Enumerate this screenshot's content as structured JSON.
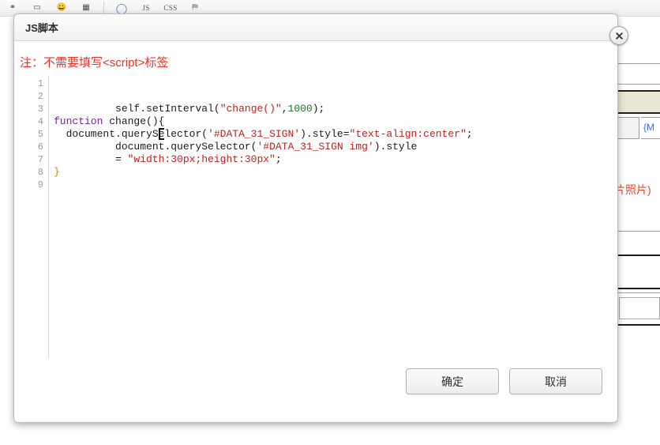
{
  "background": {
    "toolbar": {
      "items": [
        {
          "name": "link-icon",
          "glyph": "⚭"
        },
        {
          "name": "button-icon",
          "glyph": "▭"
        },
        {
          "name": "emoji-icon",
          "glyph": "😀"
        },
        {
          "name": "table-icon",
          "glyph": "▦"
        },
        {
          "name": "separator",
          "glyph": ""
        },
        {
          "name": "circle-icon",
          "glyph": "◯"
        },
        {
          "name": "js-button",
          "glyph": "JS"
        },
        {
          "name": "css-button",
          "glyph": "CSS"
        },
        {
          "name": "stamp-icon",
          "glyph": "⛿"
        }
      ]
    },
    "form": {
      "field_token": "{M",
      "red_note": "片照片)"
    }
  },
  "dialog": {
    "title": "JS脚本",
    "close_label": "✕",
    "notice": "注：不需要填写<script>标签",
    "notice_color": "#e8332a",
    "editor": {
      "line_numbers": [
        "1",
        "2",
        "3",
        "4",
        "5",
        "6",
        "7",
        "8",
        "9"
      ],
      "lines": [
        [
          {
            "t": "          ",
            "c": "plain"
          },
          {
            "t": "self",
            "c": "plain"
          },
          {
            "t": ".",
            "c": "punc"
          },
          {
            "t": "setInterval",
            "c": "plain"
          },
          {
            "t": "(",
            "c": "punc"
          },
          {
            "t": "\"change()\"",
            "c": "str"
          },
          {
            "t": ",",
            "c": "punc"
          },
          {
            "t": "1000",
            "c": "num"
          },
          {
            "t": ");",
            "c": "punc"
          }
        ],
        [
          {
            "t": "function",
            "c": "kw"
          },
          {
            "t": " change",
            "c": "plain"
          },
          {
            "t": "(){",
            "c": "punc"
          }
        ],
        [
          {
            "t": "  document",
            "c": "plain"
          },
          {
            "t": ".",
            "c": "punc"
          },
          {
            "t": "querySelector",
            "c": "plain"
          },
          {
            "t": "(",
            "c": "punc"
          },
          {
            "t": "'#DATA_31_SIGN'",
            "c": "str"
          },
          {
            "t": ")",
            "c": "punc"
          },
          {
            "t": ".style",
            "c": "plain"
          },
          {
            "t": "=",
            "c": "punc"
          },
          {
            "t": "\"text-align:center\"",
            "c": "str"
          },
          {
            "t": ";",
            "c": "punc"
          }
        ],
        [
          {
            "t": "          document",
            "c": "plain"
          },
          {
            "t": ".",
            "c": "punc"
          },
          {
            "t": "querySelector",
            "c": "plain"
          },
          {
            "t": "(",
            "c": "punc"
          },
          {
            "t": "'#DATA_31_SIGN img'",
            "c": "str"
          },
          {
            "t": ")",
            "c": "punc"
          },
          {
            "t": ".style",
            "c": "plain"
          }
        ],
        [
          {
            "t": "          = ",
            "c": "punc"
          },
          {
            "t": "\"width:30px;height:30px\"",
            "c": "str"
          },
          {
            "t": ";",
            "c": "punc"
          }
        ],
        [
          {
            "t": "}",
            "c": "brace"
          }
        ],
        [],
        [],
        []
      ]
    },
    "footer": {
      "confirm_label": "确定",
      "cancel_label": "取消"
    }
  }
}
